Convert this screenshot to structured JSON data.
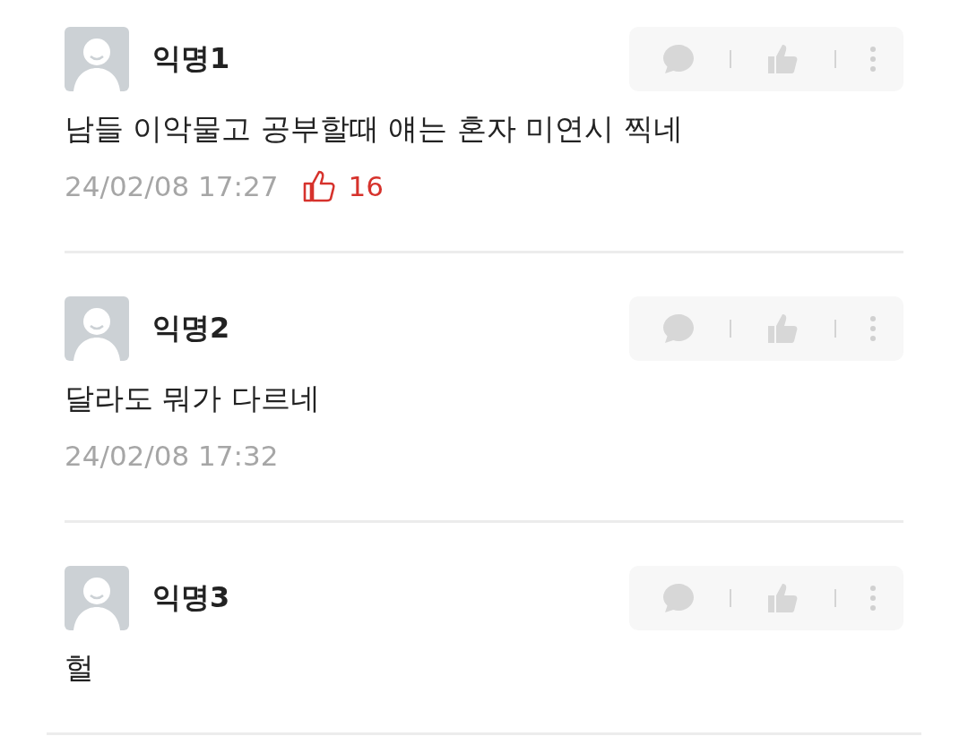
{
  "comments": [
    {
      "author": "익명1",
      "text": "남들 이악물고 공부할때 얘는 혼자 미연시 찍네",
      "date": "24/02/08 17:27",
      "likes": "16"
    },
    {
      "author": "익명2",
      "text": "달라도 뭐가 다르네",
      "date": "24/02/08 17:32"
    },
    {
      "author": "익명3",
      "text": "헐"
    }
  ]
}
